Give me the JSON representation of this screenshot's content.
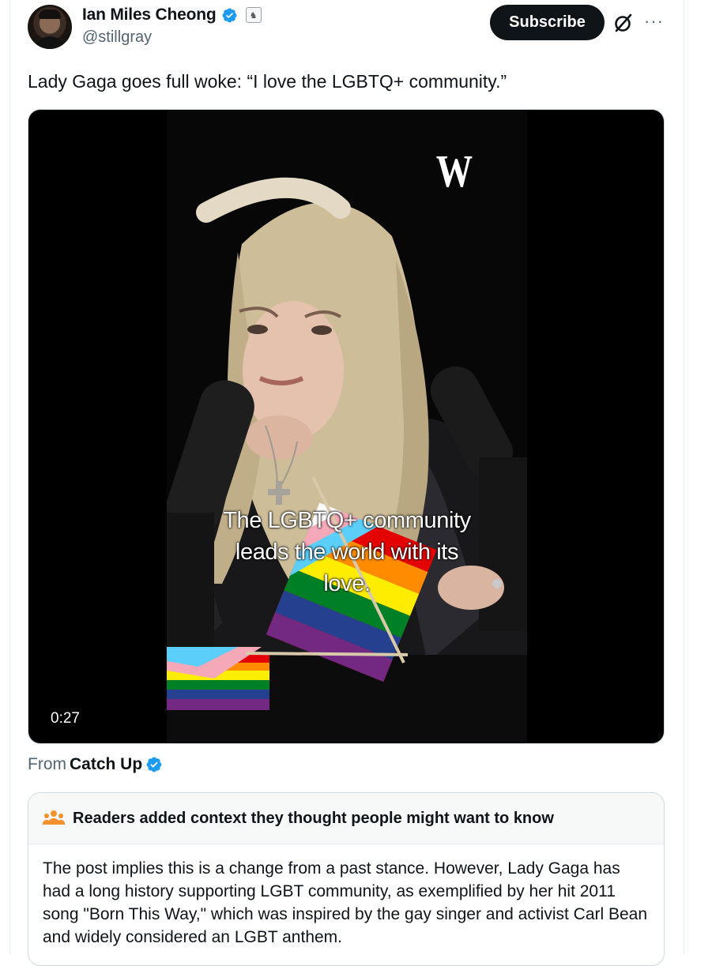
{
  "author": {
    "name": "Ian Miles Cheong",
    "handle": "@stillgray",
    "avatar_icon": "avatar-icon",
    "verified_color": "#1d9bf0"
  },
  "header": {
    "subscribe_label": "Subscribe",
    "grok_icon": "grok-icon",
    "more_label": "···"
  },
  "post": {
    "text": "Lady Gaga goes full woke: “I love the LGBTQ+ community.”"
  },
  "media": {
    "duration": "0:27",
    "caption_lines": [
      "The LGBTQ+ community",
      "leads the world with its",
      "love."
    ],
    "logo_text": "W"
  },
  "source": {
    "from_label": "From",
    "channel": "Catch Up"
  },
  "community_note": {
    "heading": "Readers added context they thought people might want to know",
    "body": "The post implies this is a change from a past stance. However, Lady Gaga has had a long history supporting LGBT community, as exemplified by her hit 2011 song \"Born This Way,\" which was inspired by the gay singer and activist Carl Bean and widely considered an LGBT anthem."
  },
  "colors": {
    "text_primary": "#0f1419",
    "text_secondary": "#536471",
    "note_icon": "#f4902e",
    "border": "#cfd9de"
  }
}
